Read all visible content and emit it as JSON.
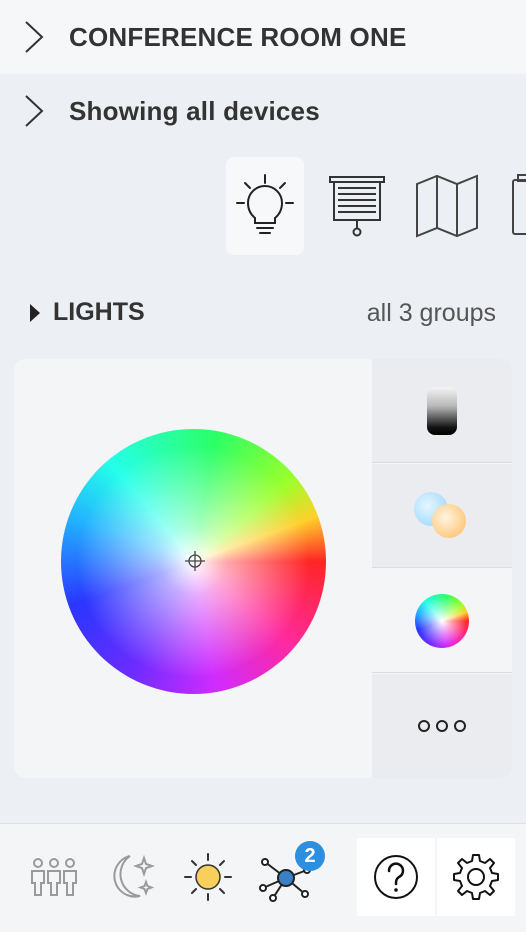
{
  "header": {
    "room_name": "CONFERENCE ROOM ONE",
    "device_filter": "Showing all devices"
  },
  "category_tabs": [
    {
      "icon": "lightbulb-icon",
      "selected": true
    },
    {
      "icon": "projector-screen-icon",
      "selected": false
    },
    {
      "icon": "map-icon",
      "selected": false
    },
    {
      "icon": "device-icon",
      "selected": false
    }
  ],
  "section": {
    "title": "LIGHTS",
    "group_count": "all 3 groups"
  },
  "color_modes": [
    {
      "icon": "brightness-swatch-icon"
    },
    {
      "icon": "color-temperature-icon"
    },
    {
      "icon": "color-wheel-icon",
      "selected": true
    },
    {
      "icon": "more-options-icon"
    }
  ],
  "bottom_bar": {
    "items": [
      "occupancy-icon",
      "night-scene-icon",
      "day-scene-icon",
      "network-icon",
      "help-icon",
      "settings-icon"
    ],
    "network_badge": "2",
    "colors": {
      "badge": "#2d8fe0",
      "sun": "#f7cf5a",
      "network_node": "#3b7fc4"
    }
  }
}
